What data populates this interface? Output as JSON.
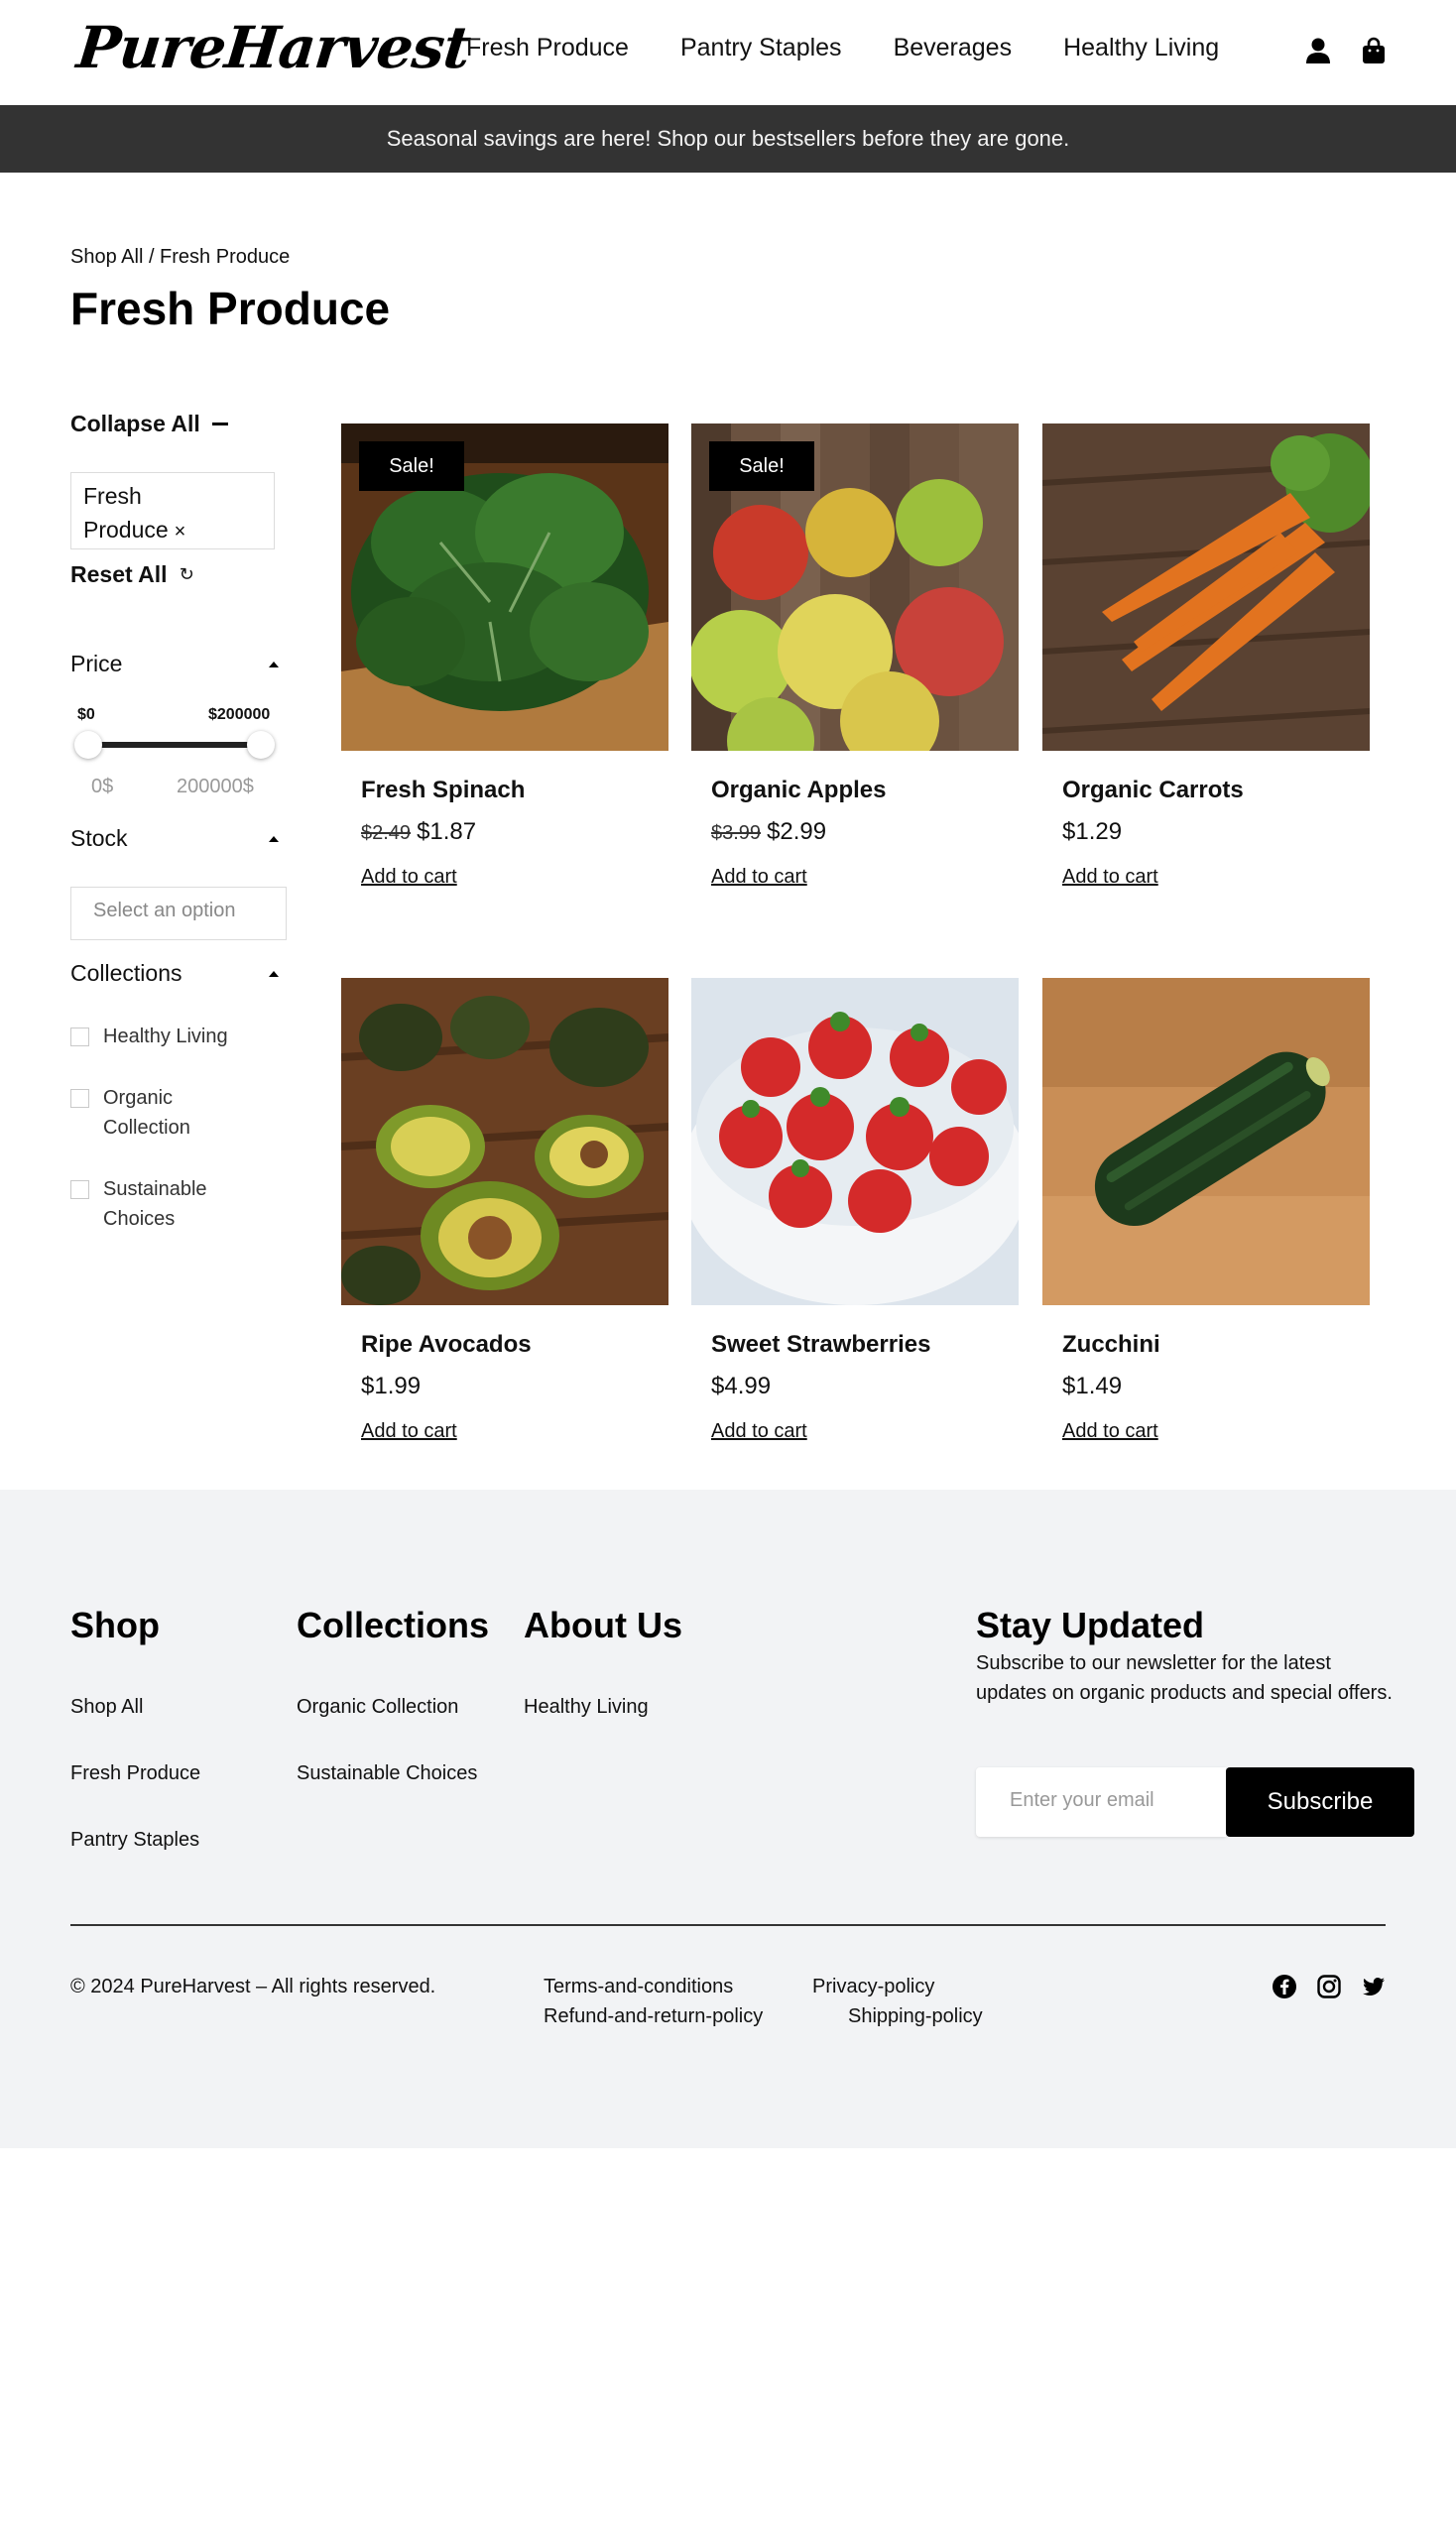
{
  "brand": {
    "logo": "PureHarvest"
  },
  "nav": [
    {
      "label": "Fresh Produce"
    },
    {
      "label": "Pantry Staples"
    },
    {
      "label": "Beverages"
    },
    {
      "label": "Healthy Living"
    }
  ],
  "header_icons": [
    "account-icon",
    "shopping-bag-icon"
  ],
  "banner": {
    "text": "Seasonal savings are here! Shop our bestsellers before they are gone."
  },
  "breadcrumb": "Shop All / Fresh Produce",
  "page_title": "Fresh Produce",
  "filters": {
    "collapse_all": "Collapse All",
    "active_chip_line1": "Fresh",
    "active_chip_line2": "Produce",
    "chip_remove": "×",
    "reset_all": "Reset All",
    "reset_icon": "↻",
    "price": {
      "heading": "Price",
      "min_label": "$0",
      "max_label": "$200000",
      "min_value": "0$",
      "max_value": "200000$",
      "range_low": 0,
      "range_high": 200000
    },
    "stock": {
      "heading": "Stock",
      "placeholder": "Select an option"
    },
    "collections": {
      "heading": "Collections",
      "options": [
        {
          "line1": "Healthy Living",
          "line2": "",
          "checked": false
        },
        {
          "line1": "Organic",
          "line2": "Collection",
          "checked": false
        },
        {
          "line1": "Sustainable",
          "line2": "Choices",
          "checked": false
        }
      ]
    }
  },
  "products": [
    {
      "name": "Fresh Spinach",
      "old_price": "$2.49",
      "price": "$1.87",
      "sale": "Sale!",
      "cart": "Add to cart"
    },
    {
      "name": "Organic Apples",
      "old_price": "$3.99",
      "price": "$2.99",
      "sale": "Sale!",
      "cart": "Add to cart"
    },
    {
      "name": "Organic Carrots",
      "old_price": "",
      "price": "$1.29",
      "sale": "",
      "cart": "Add to cart"
    },
    {
      "name": "Ripe Avocados",
      "old_price": "",
      "price": "$1.99",
      "sale": "",
      "cart": "Add to cart"
    },
    {
      "name": "Sweet Strawberries",
      "old_price": "",
      "price": "$4.99",
      "sale": "",
      "cart": "Add to cart"
    },
    {
      "name": "Zucchini",
      "old_price": "",
      "price": "$1.49",
      "sale": "",
      "cart": "Add to cart"
    }
  ],
  "footer": {
    "shop": {
      "heading": "Shop",
      "links": [
        "Shop All",
        "Fresh Produce",
        "Pantry Staples"
      ]
    },
    "collections": {
      "heading": "Collections",
      "links": [
        "Organic Collection",
        "Sustainable Choices"
      ]
    },
    "about": {
      "heading": "About Us",
      "links": [
        "Healthy Living"
      ]
    },
    "newsletter": {
      "heading": "Stay Updated",
      "text": "Subscribe to our newsletter for the latest updates on organic products and special offers.",
      "placeholder": "Enter your email",
      "button": "Subscribe"
    },
    "copyright": "© 2024 PureHarvest – All rights reserved.",
    "policies": [
      "Terms-and-conditions",
      "Privacy-policy",
      "Refund-and-return-policy",
      "Shipping-policy"
    ],
    "social": [
      "facebook-icon",
      "instagram-icon",
      "twitter-icon"
    ]
  }
}
